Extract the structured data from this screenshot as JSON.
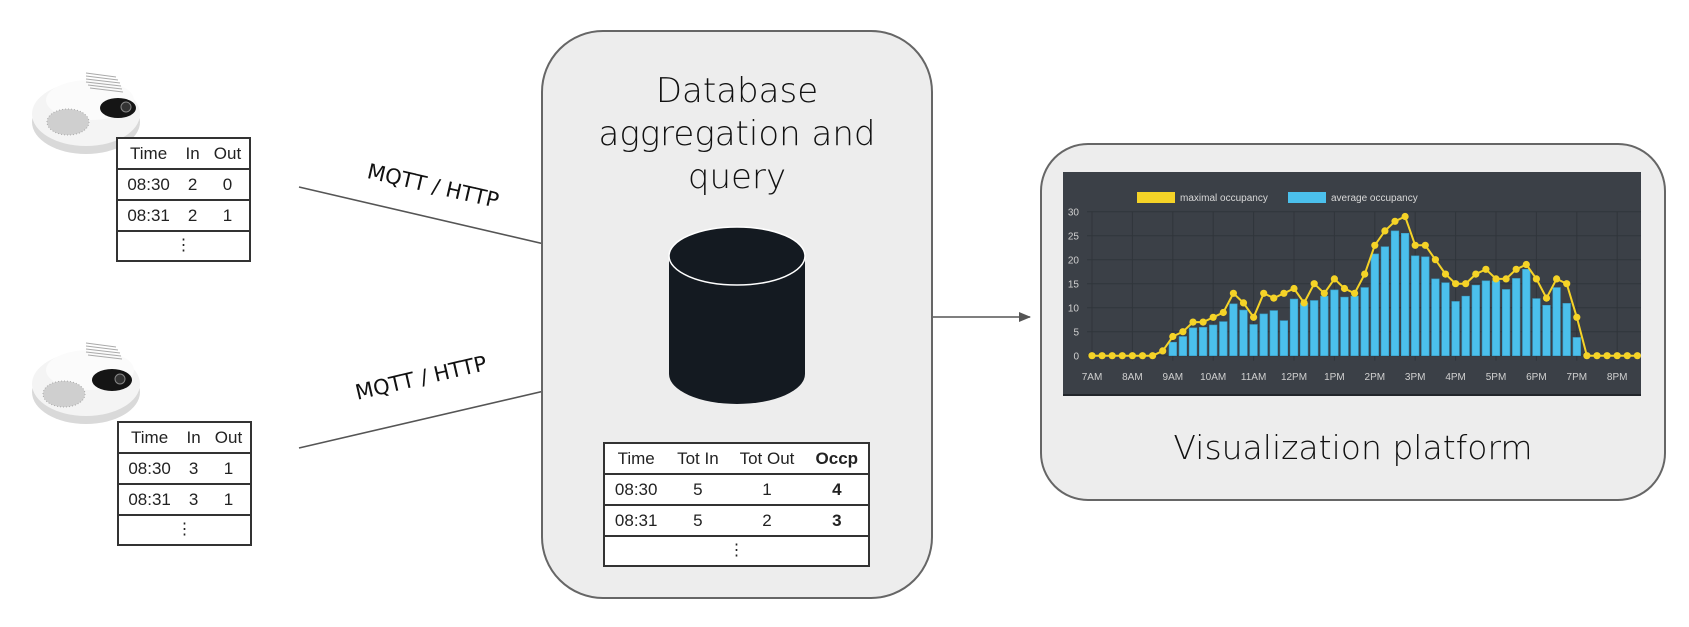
{
  "sensors": [
    {
      "table": {
        "headers": [
          "Time",
          "In",
          "Out"
        ],
        "rows": [
          [
            "08:30",
            "2",
            "0"
          ],
          [
            "08:31",
            "2",
            "1"
          ]
        ],
        "ellipsis": "⋮"
      }
    },
    {
      "table": {
        "headers": [
          "Time",
          "In",
          "Out"
        ],
        "rows": [
          [
            "08:30",
            "3",
            "1"
          ],
          [
            "08:31",
            "3",
            "1"
          ]
        ],
        "ellipsis": "⋮"
      }
    }
  ],
  "links": {
    "top_label": "MQTT / HTTP",
    "bottom_label": "MQTT / HTTP"
  },
  "database": {
    "title_lines": [
      "Database",
      "aggregation and",
      "query"
    ],
    "icon": "database-cylinder-icon",
    "table": {
      "headers": [
        "Time",
        "Tot In",
        "Tot Out",
        "Occp"
      ],
      "rows": [
        [
          "08:30",
          "5",
          "1",
          "4"
        ],
        [
          "08:31",
          "5",
          "2",
          "3"
        ]
      ],
      "ellipsis": "⋮"
    }
  },
  "visualization": {
    "title": "Visualization platform"
  },
  "colors": {
    "max_line": "#f5d327",
    "avg_bar": "#4bc0ec",
    "chart_bg": "#3b4047",
    "box_bg": "#ededed"
  },
  "chart_data": {
    "type": "bar+line",
    "legend_position": "top",
    "grid": true,
    "ylim": [
      0,
      30
    ],
    "yticks": [
      "0",
      "5",
      "10",
      "15",
      "20",
      "25",
      "30"
    ],
    "xticks": [
      "7AM",
      "8AM",
      "9AM",
      "10AM",
      "11AM",
      "12PM",
      "1PM",
      "2PM",
      "3PM",
      "4PM",
      "5PM",
      "6PM",
      "7PM",
      "8PM"
    ],
    "x": [
      "7:00",
      "7:15",
      "7:30",
      "7:45",
      "8:00",
      "8:15",
      "8:30",
      "8:45",
      "9:00",
      "9:15",
      "9:30",
      "9:45",
      "10:00",
      "10:15",
      "10:30",
      "10:45",
      "11:00",
      "11:15",
      "11:30",
      "11:45",
      "12:00",
      "12:15",
      "12:30",
      "12:45",
      "13:00",
      "13:15",
      "13:30",
      "13:45",
      "14:00",
      "14:15",
      "14:30",
      "14:45",
      "15:00",
      "15:15",
      "15:30",
      "15:45",
      "16:00",
      "16:15",
      "16:30",
      "16:45",
      "17:00",
      "17:15",
      "17:30",
      "17:45",
      "18:00",
      "18:15",
      "18:30",
      "18:45",
      "19:00",
      "19:15",
      "19:30",
      "19:45",
      "20:00",
      "20:15",
      "20:30"
    ],
    "series": [
      {
        "name": "maximal occupancy",
        "type": "line",
        "values": [
          0,
          0,
          0,
          0,
          0,
          0,
          0,
          1,
          4,
          5,
          7,
          7,
          8,
          9,
          13,
          11,
          8,
          13,
          12,
          13,
          14,
          11,
          15,
          13,
          16,
          14,
          13,
          17,
          23,
          26,
          28,
          29,
          23,
          23,
          20,
          17,
          15,
          15,
          17,
          18,
          16,
          16,
          18,
          19,
          16,
          12,
          16,
          15,
          8,
          0,
          0,
          0,
          0,
          0,
          0
        ]
      },
      {
        "name": "average occupancy",
        "type": "bar",
        "values": [
          0,
          0,
          0,
          0,
          0,
          0,
          0,
          0,
          2.8,
          4,
          5.8,
          5.9,
          6.4,
          7.1,
          10.8,
          9.5,
          6.5,
          8.7,
          9.4,
          7.3,
          11.8,
          10.9,
          11.5,
          12.4,
          13.7,
          12.2,
          12.4,
          14.2,
          21.2,
          22.7,
          26,
          25.5,
          20.8,
          20.6,
          16,
          15.2,
          11.3,
          12.4,
          14.7,
          15.6,
          15.6,
          13.8,
          16.1,
          18,
          11.9,
          10.5,
          14.2,
          10.9,
          3.8,
          0,
          0,
          0,
          0,
          0,
          0
        ]
      }
    ]
  }
}
